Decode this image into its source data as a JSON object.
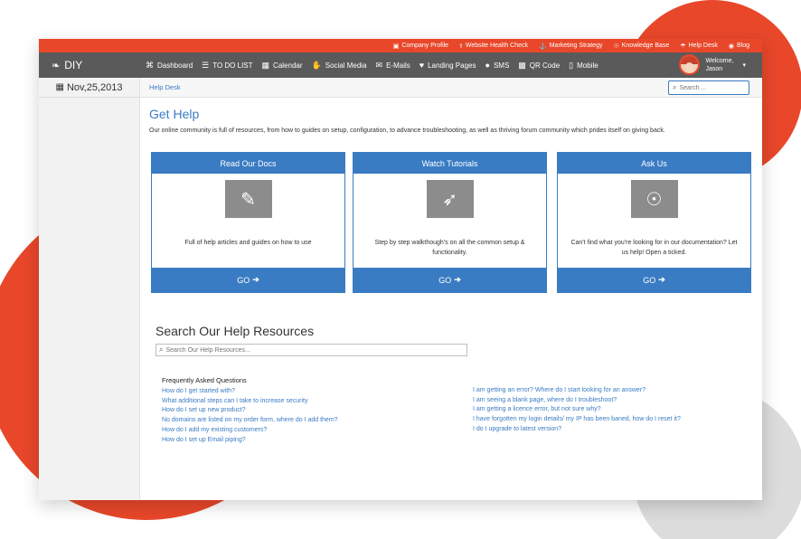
{
  "top_links": [
    {
      "label": "Company Profile",
      "icon": "building-icon",
      "glyph": "▣"
    },
    {
      "label": "Website Health Check",
      "icon": "stethoscope-icon",
      "glyph": "⚕"
    },
    {
      "label": "Marketing Strategy",
      "icon": "anchor-icon",
      "glyph": "⚓"
    },
    {
      "label": "Knowledge Base",
      "icon": "lightbulb-icon",
      "glyph": "☉"
    },
    {
      "label": "Help Desk",
      "icon": "umbrella-icon",
      "glyph": "☂"
    },
    {
      "label": "Blog",
      "icon": "comments-icon",
      "glyph": "◉"
    }
  ],
  "brand": {
    "name": "DIY",
    "icon": "leaf-icon",
    "glyph": "❧"
  },
  "nav": [
    {
      "label": "Dashboard",
      "icon": "dashboard-icon",
      "glyph": "⌘"
    },
    {
      "label": "TO DO LIST",
      "icon": "list-icon",
      "glyph": "☰"
    },
    {
      "label": "Calendar",
      "icon": "calendar-icon",
      "glyph": "▦"
    },
    {
      "label": "Social Media",
      "icon": "thumbs-up-icon",
      "glyph": "✋"
    },
    {
      "label": "E-Mails",
      "icon": "envelope-icon",
      "glyph": "✉"
    },
    {
      "label": "Landing Pages",
      "icon": "heart-icon",
      "glyph": "♥"
    },
    {
      "label": "SMS",
      "icon": "comment-icon",
      "glyph": "●"
    },
    {
      "label": "QR Code",
      "icon": "qrcode-icon",
      "glyph": "▩"
    },
    {
      "label": "Mobile",
      "icon": "mobile-icon",
      "glyph": "▯"
    }
  ],
  "user": {
    "welcome": "Welcome,",
    "name": "Jason",
    "caret": "▾"
  },
  "sidebar": {
    "date": "Nov,25,2013",
    "date_glyph": "▦"
  },
  "breadcrumb": "Help Desk",
  "search_top": {
    "placeholder": "Search ...",
    "glyph": "⌕"
  },
  "page": {
    "title": "Get Help",
    "intro": "Our online community is full of resources, from how to guides on setup, configuration, to advance troubleshooting, as well as thriving forum community which prides itself on giving back."
  },
  "cards": [
    {
      "title": "Read Our Docs",
      "icon": "edit-icon",
      "glyph": "✎",
      "desc": "Full of help articles and guides on how to use",
      "go": "GO",
      "arrow": "➔"
    },
    {
      "title": "Watch Tutorials",
      "icon": "rocket-icon",
      "glyph": "➶",
      "desc": "Step by step walkthough's on all the common setup & functionality.",
      "go": "GO",
      "arrow": "➔"
    },
    {
      "title": "Ask Us",
      "icon": "lightbulb-icon",
      "glyph": "☉",
      "desc": "Can't find what you're looking for in our documentation? Let us help! Open a ticked.",
      "go": "GO",
      "arrow": "➔"
    }
  ],
  "help_search": {
    "title": "Search Our Help Resources",
    "placeholder": "Search Our Help Resources...",
    "glyph": "⌕"
  },
  "faq": {
    "heading": "Frequently Asked Questions",
    "left": [
      "How do I get started with?",
      "What additional steps can I take to increase security",
      "How do I set up new product?",
      "No domains are listed on my order form, where do I add them?",
      "How do I add my existing customers?",
      "How do I set up Email piping?"
    ],
    "right": [
      "I am getting an error? Where do I start looking for an answer?",
      "I am seeing a blank page, where do I troubleshoot?",
      "I am getting a licence error, but not sure why?",
      "I have forgotten my login details/ my IP has been baned, how do I reset it?",
      "I do I upgrade to latest version?"
    ]
  },
  "colors": {
    "accent": "#e8472a",
    "primary": "#3a7cc3",
    "navbar": "#5a5a5a",
    "icon_bg": "#8c8c8c"
  }
}
